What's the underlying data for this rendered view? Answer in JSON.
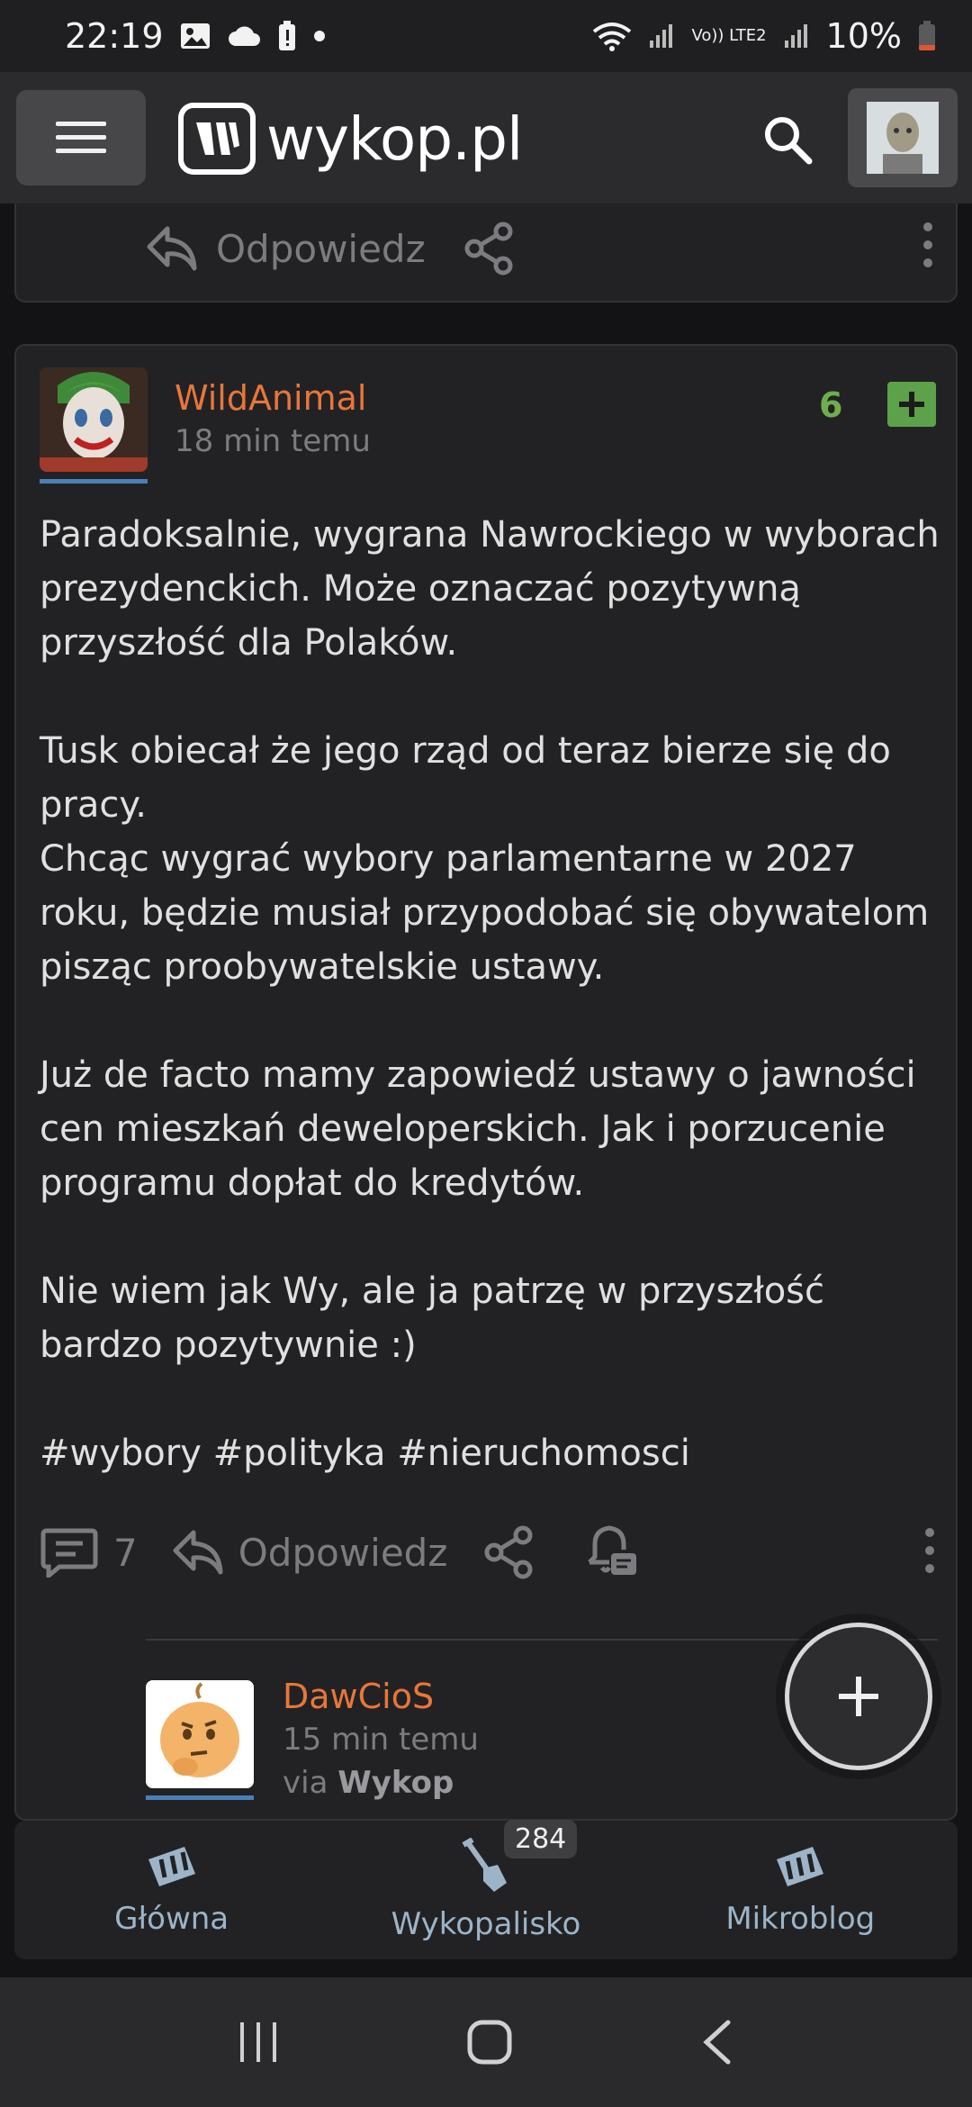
{
  "status_bar": {
    "time": "22:19",
    "battery": "10%",
    "network_label": "Vo)) LTE2"
  },
  "app_bar": {
    "logo_text": "wykop.pl"
  },
  "prev_card": {
    "reply_label": "Odpowiedz"
  },
  "post": {
    "author": "WildAnimal",
    "time": "18 min temu",
    "votes": "6",
    "paragraphs": [
      "Paradoksalnie, wygrana Nawrockiego w wyborach prezydenckich. Może oznaczać pozytywną przyszłość dla Polaków.",
      "Tusk obiecał że jego rząd od teraz bierze się do pracy.",
      "Chcąc wygrać wybory parlamentarne w 2027 roku, będzie musiał przypodobać się obywatelom pisząc proobywatelskie ustawy.",
      "Już de facto mamy zapowiedź ustawy o jawności cen mieszkań deweloperskich. Jak i porzucenie programu dopłat do kredytów.",
      "Nie wiem jak Wy, ale ja patrzę w przyszłość bardzo pozytywnie :)",
      "#wybory #polityka #nieruchomosci"
    ],
    "comment_count": "7",
    "reply_label": "Odpowiedz"
  },
  "reply": {
    "author": "DawCioS",
    "time": "15 min temu",
    "via_prefix": "via",
    "via_app": "Wykop"
  },
  "bottom_nav": {
    "items": [
      {
        "label": "Główna"
      },
      {
        "label": "Wykopalisko",
        "badge": "284"
      },
      {
        "label": "Mikroblog"
      }
    ]
  },
  "colors": {
    "author": "#e8763a",
    "vote": "#5da14a",
    "nav_label": "#9db4c8"
  }
}
